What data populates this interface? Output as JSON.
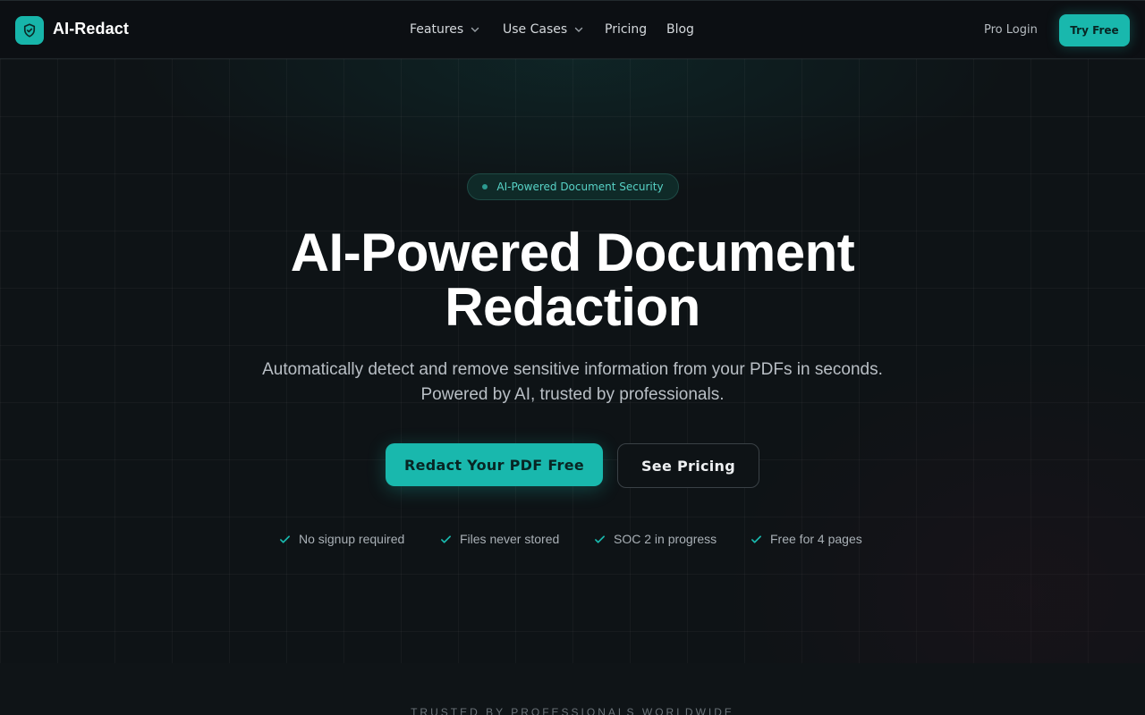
{
  "brand": {
    "name": "AI-Redact"
  },
  "nav": {
    "links": [
      {
        "label": "Features",
        "dropdown": true
      },
      {
        "label": "Use Cases",
        "dropdown": true
      },
      {
        "label": "Pricing",
        "dropdown": false
      },
      {
        "label": "Blog",
        "dropdown": false
      }
    ],
    "pro_login": "Pro Login",
    "try_free": "Try Free"
  },
  "hero": {
    "badge": "AI-Powered Document Security",
    "title_line1": "AI-Powered Document",
    "title_line2": "Redaction",
    "subtitle": "Automatically detect and remove sensitive information from your PDFs in seconds. Powered by AI, trusted by professionals.",
    "primary_cta": "Redact Your PDF Free",
    "secondary_cta": "See Pricing",
    "checks": [
      "No signup required",
      "Files never stored",
      "SOC 2 in progress",
      "Free for 4 pages"
    ]
  },
  "trusted": {
    "label": "TRUSTED BY PROFESSIONALS WORLDWIDE"
  },
  "colors": {
    "accent": "#19b8ad",
    "background": "#0d1114",
    "badge_text": "#57d2c6"
  },
  "icons": {
    "logo": "shield-check-icon",
    "dropdown": "chevron-down-icon",
    "check": "check-icon"
  }
}
